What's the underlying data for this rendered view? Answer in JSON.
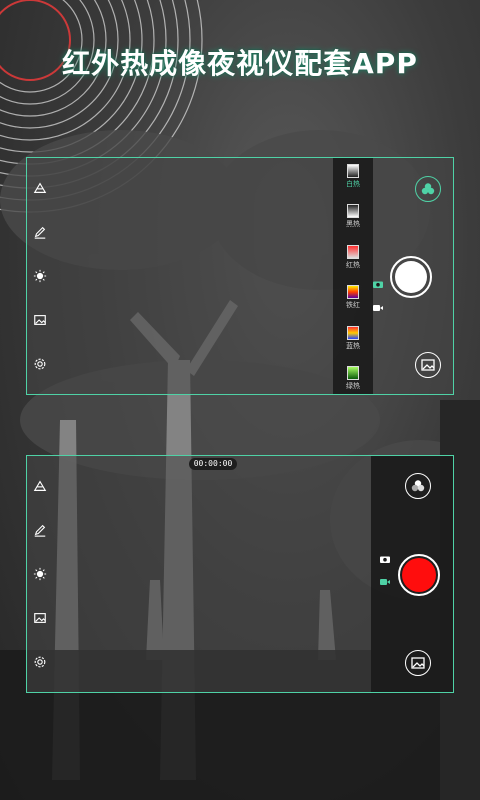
{
  "headline": "红外热成像夜视仪配套APP",
  "colors": {
    "accent": "#4fd2a6",
    "record": "#ff0d0d",
    "panel": "#1a1a1a"
  },
  "toolbar": {
    "icons": [
      "calibrate-icon",
      "edit-icon",
      "brightness-icon",
      "gallery-picture-icon",
      "settings-icon"
    ]
  },
  "palettes": [
    {
      "label": "白热",
      "key": "white-hot",
      "active": true
    },
    {
      "label": "黑热",
      "key": "black-hot",
      "active": false
    },
    {
      "label": "红热",
      "key": "red-hot",
      "active": false
    },
    {
      "label": "铁红",
      "key": "iron-red",
      "active": false
    },
    {
      "label": "蓝热",
      "key": "blue-hot",
      "active": false
    },
    {
      "label": "绿热",
      "key": "green-hot",
      "active": false
    }
  ],
  "recording": {
    "timer": "00:00:00"
  },
  "modes": {
    "photo": "camera-icon",
    "video": "video-icon"
  }
}
